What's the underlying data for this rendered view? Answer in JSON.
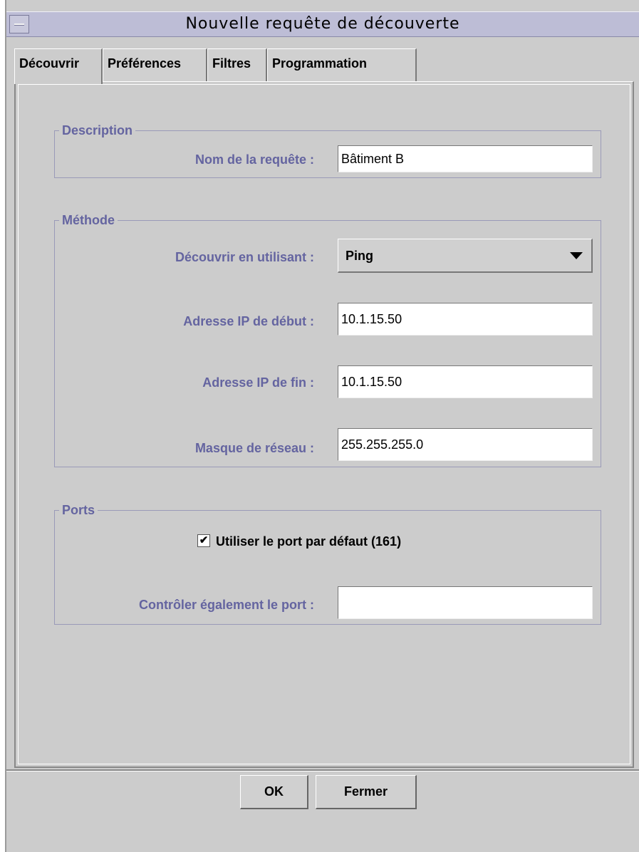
{
  "window": {
    "title": "Nouvelle requête de découverte"
  },
  "tabs": [
    {
      "label": "Découvrir",
      "active": true
    },
    {
      "label": "Préférences",
      "active": false
    },
    {
      "label": "Filtres",
      "active": false
    },
    {
      "label": "Programmation",
      "active": false
    }
  ],
  "description": {
    "legend": "Description",
    "query_name_label": "Nom de la requête :",
    "query_name_value": "Bâtiment B"
  },
  "method": {
    "legend": "Méthode",
    "discover_using_label": "Découvrir en utilisant :",
    "discover_using_value": "Ping",
    "start_ip_label": "Adresse IP de début :",
    "start_ip_value": "10.1.15.50",
    "end_ip_label": "Adresse IP de fin :",
    "end_ip_value": "10.1.15.50",
    "netmask_label": "Masque de réseau :",
    "netmask_value": "255.255.255.0"
  },
  "ports": {
    "legend": "Ports",
    "default_port_label": "Utiliser le port par défaut (161)",
    "default_port_checked": true,
    "also_check_port_label": "Contrôler également le port :",
    "also_check_port_value": ""
  },
  "buttons": {
    "ok_label": "OK",
    "close_label": "Fermer"
  },
  "icons": {
    "window_menu": "window-menu-icon",
    "combo_arrow": "chevron-down-icon",
    "check": "checkmark-icon"
  },
  "colors": {
    "titlebar": "#bdbdd6",
    "label_text": "#6464a0",
    "background": "#cccccc"
  }
}
